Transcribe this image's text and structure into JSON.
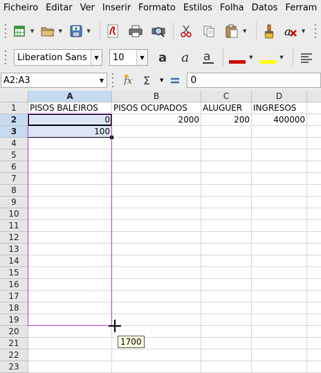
{
  "menu": [
    "Ficheiro",
    "Editar",
    "Ver",
    "Inserir",
    "Formato",
    "Estilos",
    "Folha",
    "Datos",
    "Ferram"
  ],
  "toolbar": {
    "icons": [
      "new-document-icon",
      "open-folder-icon",
      "save-icon",
      "export-pdf-icon",
      "print-icon",
      "print-preview-icon",
      "cut-icon",
      "copy-icon",
      "paste-icon",
      "clone-formatting-icon",
      "clear-formatting-icon"
    ]
  },
  "format_bar": {
    "font_name": "Liberation Sans",
    "font_size": "10",
    "font_color": "#cc0000",
    "highlight_color": "#ffff00"
  },
  "formula_bar": {
    "name_box": "A2:A3",
    "input": "0"
  },
  "columns": [
    {
      "letter": "A",
      "selected": true
    },
    {
      "letter": "B",
      "selected": false
    },
    {
      "letter": "C",
      "selected": false
    },
    {
      "letter": "D",
      "selected": false
    }
  ],
  "rows": [
    "1",
    "2",
    "3",
    "4",
    "5",
    "6",
    "7",
    "8",
    "9",
    "10",
    "11",
    "12",
    "13",
    "14",
    "15",
    "16",
    "17",
    "18",
    "19",
    "20",
    "21",
    "22",
    "23"
  ],
  "selected_rows": [
    "2",
    "3"
  ],
  "cells": {
    "A1": "PISOS BALEIROS",
    "B1": "PISOS OCUPADOS",
    "C1": "ALUGUER",
    "D1": "INGRESOS",
    "A2": "0",
    "B2": "2000",
    "C2": "200",
    "D2": "400000",
    "A3": "100"
  },
  "autofill_tooltip": "1700",
  "colors": {
    "selection": "#c6daf2",
    "autofill_border": "#b038c0"
  }
}
